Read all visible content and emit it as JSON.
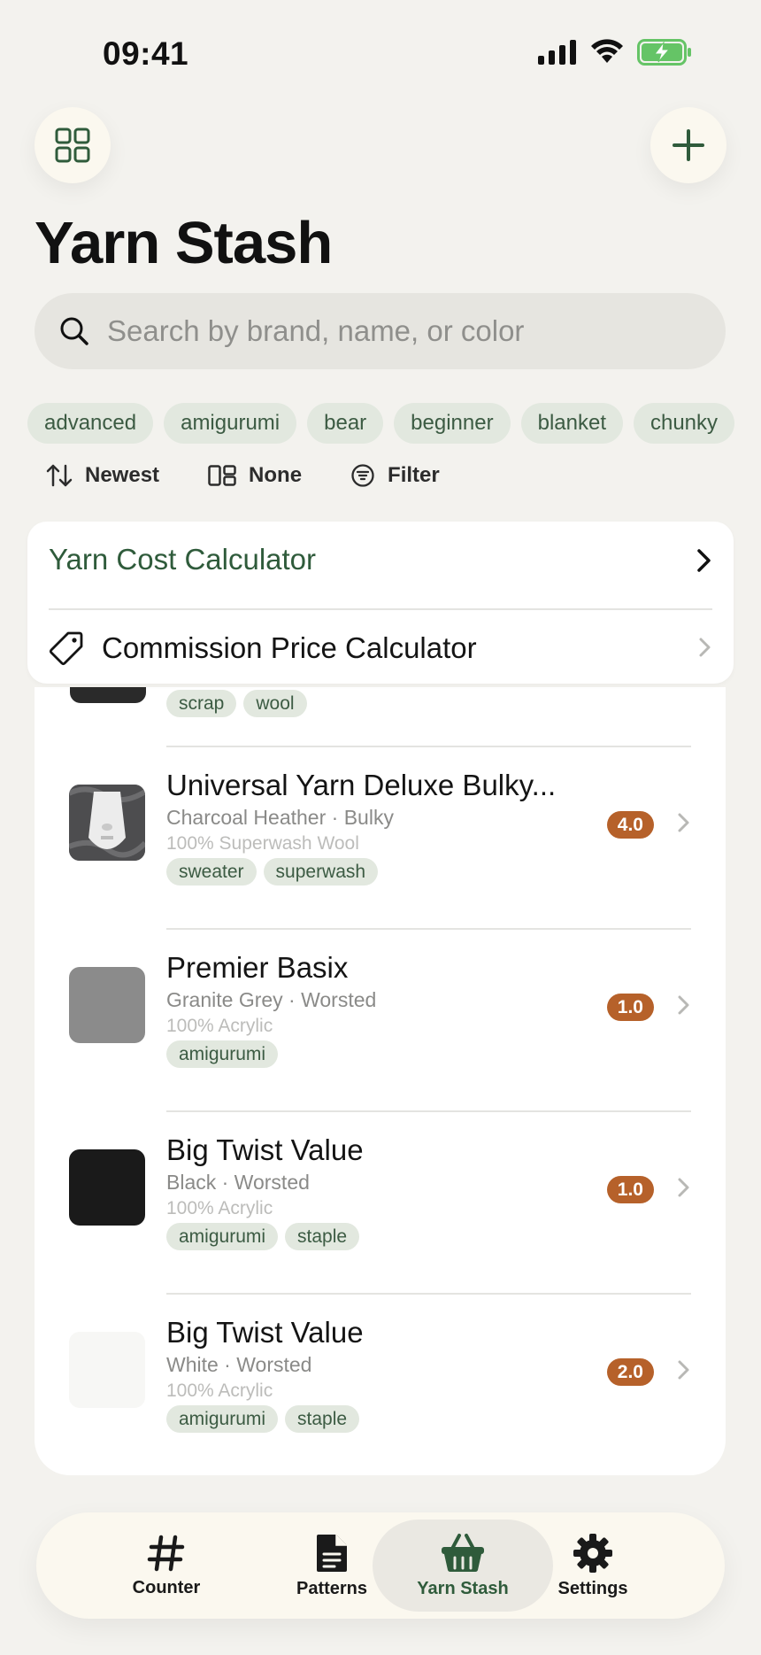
{
  "status_bar": {
    "time": "09:41"
  },
  "header": {
    "title": "Yarn Stash",
    "search_placeholder": "Search by brand, name, or color"
  },
  "chips": [
    "advanced",
    "amigurumi",
    "bear",
    "beginner",
    "blanket",
    "chunky"
  ],
  "sort_bar": {
    "sort": "Newest",
    "group": "None",
    "filter": "Filter"
  },
  "calculators": {
    "yarn_cost": "Yarn Cost Calculator",
    "commission": "Commission Price Calculator"
  },
  "partial_item": {
    "tags": [
      "scrap",
      "wool"
    ]
  },
  "yarns": [
    {
      "name": "Universal Yarn Deluxe Bulky...",
      "subtitle": "Charcoal Heather · Bulky",
      "fiber": "100% Superwash Wool",
      "tags": [
        "sweater",
        "superwash"
      ],
      "quantity": "4.0",
      "swatch_color": "photo"
    },
    {
      "name": "Premier Basix",
      "subtitle": "Granite Grey · Worsted",
      "fiber": "100% Acrylic",
      "tags": [
        "amigurumi"
      ],
      "quantity": "1.0",
      "swatch_color": "#8b8b8b"
    },
    {
      "name": "Big Twist Value",
      "subtitle": "Black · Worsted",
      "fiber": "100% Acrylic",
      "tags": [
        "amigurumi",
        "staple"
      ],
      "quantity": "1.0",
      "swatch_color": "#1a1a1a"
    },
    {
      "name": "Big Twist Value",
      "subtitle": "White · Worsted",
      "fiber": "100% Acrylic",
      "tags": [
        "amigurumi",
        "staple"
      ],
      "quantity": "2.0",
      "swatch_color": "#f7f7f5"
    }
  ],
  "tabs": [
    {
      "label": "Counter",
      "icon": "hash-icon",
      "active": false
    },
    {
      "label": "Patterns",
      "icon": "document-icon",
      "active": false
    },
    {
      "label": "Yarn Stash",
      "icon": "basket-icon",
      "active": true
    },
    {
      "label": "Settings",
      "icon": "gear-icon",
      "active": false
    }
  ],
  "colors": {
    "accent_green": "#2f5b3b",
    "badge_orange": "#b6612a",
    "chip_bg": "#e2e8df",
    "battery_green": "#65c466"
  }
}
